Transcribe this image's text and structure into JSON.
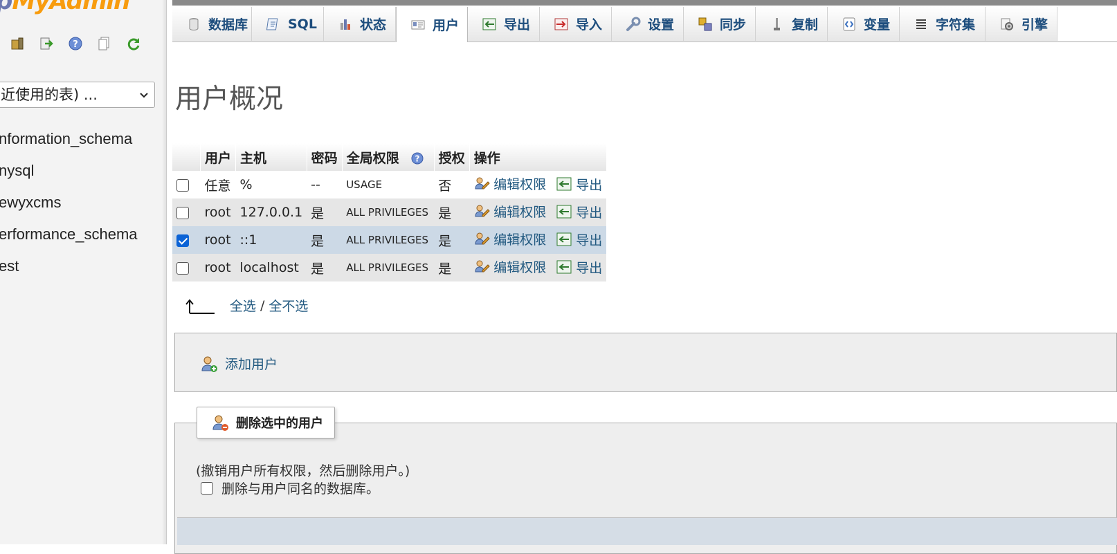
{
  "nav": {
    "logo_part1": "p",
    "logo_part2": "MyAdmin",
    "icons": [
      "home-icon",
      "logout-icon",
      "help-icon",
      "docs-icon",
      "reload-icon"
    ],
    "recent_select": "近使用的表) ...",
    "databases": [
      "nformation_schema",
      "nysql",
      "ewyxcms",
      "erformance_schema",
      "est"
    ]
  },
  "tabs": [
    {
      "label": "数据库",
      "icon": "database-icon"
    },
    {
      "label": "SQL",
      "icon": "sql-icon"
    },
    {
      "label": "状态",
      "icon": "status-icon"
    },
    {
      "label": "用户",
      "icon": "users-icon",
      "active": true
    },
    {
      "label": "导出",
      "icon": "export-icon"
    },
    {
      "label": "导入",
      "icon": "import-icon"
    },
    {
      "label": "设置",
      "icon": "wrench-icon"
    },
    {
      "label": "同步",
      "icon": "sync-icon"
    },
    {
      "label": "复制",
      "icon": "replication-icon"
    },
    {
      "label": "变量",
      "icon": "variables-icon"
    },
    {
      "label": "字符集",
      "icon": "charset-icon"
    },
    {
      "label": "引擎",
      "icon": "engine-icon"
    }
  ],
  "page_title": "用户概况",
  "table": {
    "headers": {
      "user": "用户",
      "host": "主机",
      "password": "密码",
      "privileges": "全局权限",
      "grant": "授权",
      "action": "操作"
    },
    "rows": [
      {
        "user": "任意",
        "host": "%",
        "password": "--",
        "privileges": "USAGE",
        "grant": "否",
        "edit": "编辑权限",
        "export": "导出",
        "checked": false
      },
      {
        "user": "root",
        "host": "127.0.0.1",
        "password": "是",
        "privileges": "ALL PRIVILEGES",
        "grant": "是",
        "edit": "编辑权限",
        "export": "导出",
        "checked": false
      },
      {
        "user": "root",
        "host": "::1",
        "password": "是",
        "privileges": "ALL PRIVILEGES",
        "grant": "是",
        "edit": "编辑权限",
        "export": "导出",
        "checked": true
      },
      {
        "user": "root",
        "host": "localhost",
        "password": "是",
        "privileges": "ALL PRIVILEGES",
        "grant": "是",
        "edit": "编辑权限",
        "export": "导出",
        "checked": false
      }
    ]
  },
  "select_all": "全选",
  "select_sep": "/",
  "deselect_all": "全不选",
  "add_user": "添加用户",
  "delete": {
    "legend": "删除选中的用户",
    "note": "(撤销用户所有权限，然后删除用户。)",
    "drop_db_label": "删除与用户同名的数据库。"
  },
  "colors": {
    "link": "#235a81",
    "any_user": "#d8141a",
    "logo_orange": "#f89c0e",
    "logo_blue": "#6c78af",
    "marked_row": "#ccd9e6"
  }
}
